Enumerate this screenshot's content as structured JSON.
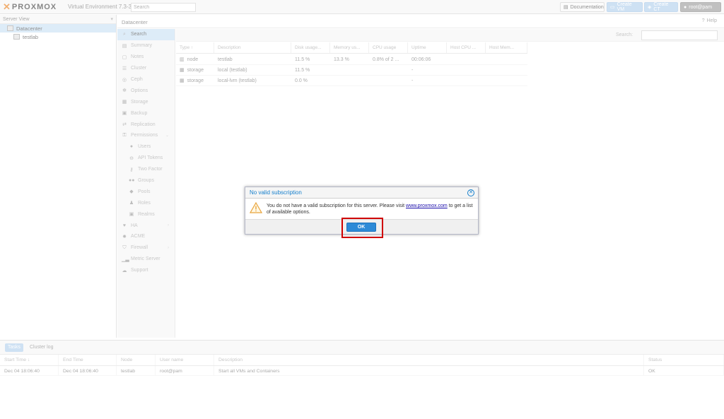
{
  "header": {
    "brand": "PROXMOX",
    "subtitle": "Virtual Environment 7.3-3",
    "search_placeholder": "Search",
    "documentation": "Documentation",
    "create_vm": "Create VM",
    "create_ct": "Create CT",
    "user": "root@pam",
    "accent": "#e57000"
  },
  "tree": {
    "header": "Server View",
    "items": [
      {
        "label": "Datacenter"
      },
      {
        "label": "testlab"
      }
    ]
  },
  "content": {
    "title": "Datacenter",
    "help": "Help"
  },
  "nav": {
    "items": [
      {
        "label": "Search",
        "icon": "search-icon"
      },
      {
        "label": "Summary",
        "icon": "book-icon"
      },
      {
        "label": "Notes",
        "icon": "notes-icon"
      },
      {
        "label": "Cluster",
        "icon": "server-icon"
      },
      {
        "label": "Ceph",
        "icon": "ceph-icon"
      },
      {
        "label": "Options",
        "icon": "gear-icon"
      },
      {
        "label": "Storage",
        "icon": "database-icon"
      },
      {
        "label": "Backup",
        "icon": "floppy-icon"
      },
      {
        "label": "Replication",
        "icon": "retweet-icon"
      },
      {
        "label": "Permissions",
        "icon": "unlock-icon"
      },
      {
        "label": "Users",
        "icon": "user-icon"
      },
      {
        "label": "API Tokens",
        "icon": "lock-icon"
      },
      {
        "label": "Two Factor",
        "icon": "key-icon"
      },
      {
        "label": "Groups",
        "icon": "users-icon"
      },
      {
        "label": "Pools",
        "icon": "tags-icon"
      },
      {
        "label": "Roles",
        "icon": "male-icon"
      },
      {
        "label": "Realms",
        "icon": "address-book-icon"
      },
      {
        "label": "HA",
        "icon": "heartbeat-icon"
      },
      {
        "label": "ACME",
        "icon": "certificate-icon"
      },
      {
        "label": "Firewall",
        "icon": "shield-icon"
      },
      {
        "label": "Metric Server",
        "icon": "chart-icon"
      },
      {
        "label": "Support",
        "icon": "comments-icon"
      }
    ]
  },
  "grid": {
    "search_label": "Search:",
    "columns": [
      "Type ↑",
      "Description",
      "Disk usage...",
      "Memory us...",
      "CPU usage",
      "Uptime",
      "Host CPU ...",
      "Host Mem..."
    ],
    "rows": [
      {
        "type": "node",
        "description": "testlab",
        "disk": "11.5 %",
        "memory": "13.3 %",
        "cpu": "0.8% of 2 ...",
        "uptime": "00:06:06",
        "host_cpu": "",
        "host_mem": ""
      },
      {
        "type": "storage",
        "description": "local (testlab)",
        "disk": "11.5 %",
        "memory": "",
        "cpu": "",
        "uptime": "-",
        "host_cpu": "",
        "host_mem": ""
      },
      {
        "type": "storage",
        "description": "local-lvm (testlab)",
        "disk": "0.0 %",
        "memory": "",
        "cpu": "",
        "uptime": "-",
        "host_cpu": "",
        "host_mem": ""
      }
    ]
  },
  "log": {
    "tabs": [
      "Tasks",
      "Cluster log"
    ],
    "columns": [
      "Start Time ↓",
      "End Time",
      "Node",
      "User name",
      "Description",
      "Status"
    ],
    "rows": [
      {
        "start": "Dec 04 18:06:40",
        "end": "Dec 04 18:06:40",
        "node": "testlab",
        "user": "root@pam",
        "description": "Start all VMs and Containers",
        "status": "OK"
      }
    ]
  },
  "dialog": {
    "title": "No valid subscription",
    "message_pre": "You do not have a valid subscription for this server. Please visit ",
    "link": "www.proxmox.com",
    "message_post": " to get a list of available options.",
    "ok": "OK"
  }
}
